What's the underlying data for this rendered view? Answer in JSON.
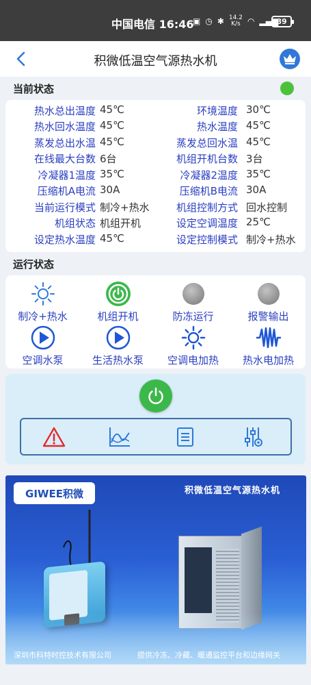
{
  "statusbar": {
    "carrier_time": "中国电信 16:46",
    "speed_value": "14.2",
    "speed_unit": "K/s",
    "battery": "89"
  },
  "header": {
    "title": "积微低温空气源热水机"
  },
  "current_status": {
    "title": "当前状态",
    "indicator_color": "#4cc23b",
    "rows": [
      {
        "label1": "热水总出温度",
        "value1": "45℃",
        "label2": "环境温度",
        "value2": "30℃"
      },
      {
        "label1": "热水回水温度",
        "value1": "45℃",
        "label2": "热水温度",
        "value2": "45℃"
      },
      {
        "label1": "蒸发总出水温",
        "value1": "45℃",
        "label2": "蒸发总回水温",
        "value2": "45℃"
      },
      {
        "label1": "在线最大台数",
        "value1": "6台",
        "label2": "机组开机台数",
        "value2": "3台"
      },
      {
        "label1": "冷凝器1温度",
        "value1": "35℃",
        "label2": "冷凝器2温度",
        "value2": "35℃"
      },
      {
        "label1": "压缩机A电流",
        "value1": "30A",
        "label2": "压缩机B电流",
        "value2": "30A"
      },
      {
        "label1": "当前运行模式",
        "value1": "制冷+热水",
        "label2": "机组控制方式",
        "value2": "回水控制"
      },
      {
        "label1": "机组状态",
        "value1": "机组开机",
        "label2": "设定空调温度",
        "value2": "25℃"
      },
      {
        "label1": "设定热水温度",
        "value1": "45℃",
        "label2": "设定控制模式",
        "value2": "制冷+热水"
      }
    ]
  },
  "run_status": {
    "title": "运行状态",
    "indicators": [
      {
        "label": "制冷+热水",
        "icon": "sun-outline-icon"
      },
      {
        "label": "机组开机",
        "icon": "power-green-icon"
      },
      {
        "label": "防冻运行",
        "icon": "gray-dot-icon"
      },
      {
        "label": "报警输出",
        "icon": "gray-dot-icon"
      },
      {
        "label": "空调水泵",
        "icon": "play-circle-icon"
      },
      {
        "label": "生活热水泵",
        "icon": "play-circle-icon"
      },
      {
        "label": "空调电加热",
        "icon": "sun-blue-icon"
      },
      {
        "label": "热水电加热",
        "icon": "heater-coil-icon"
      }
    ]
  },
  "controls": {
    "tools": [
      "alarm-icon",
      "chart-icon",
      "list-icon",
      "settings-sliders-icon"
    ]
  },
  "banner": {
    "logo_text": "GIWEE积微",
    "title": "积微低温空气源热水机",
    "footer_left": "深圳市科特时控技术有限公司",
    "footer_right": "提供冷冻、冷藏、暖通监控平台和边缘网关"
  },
  "colors": {
    "accent": "#2a3fc0",
    "header_blue": "#2f78d8",
    "on_green": "#3cb84a",
    "inactive_gray": "#9a9a9a"
  }
}
